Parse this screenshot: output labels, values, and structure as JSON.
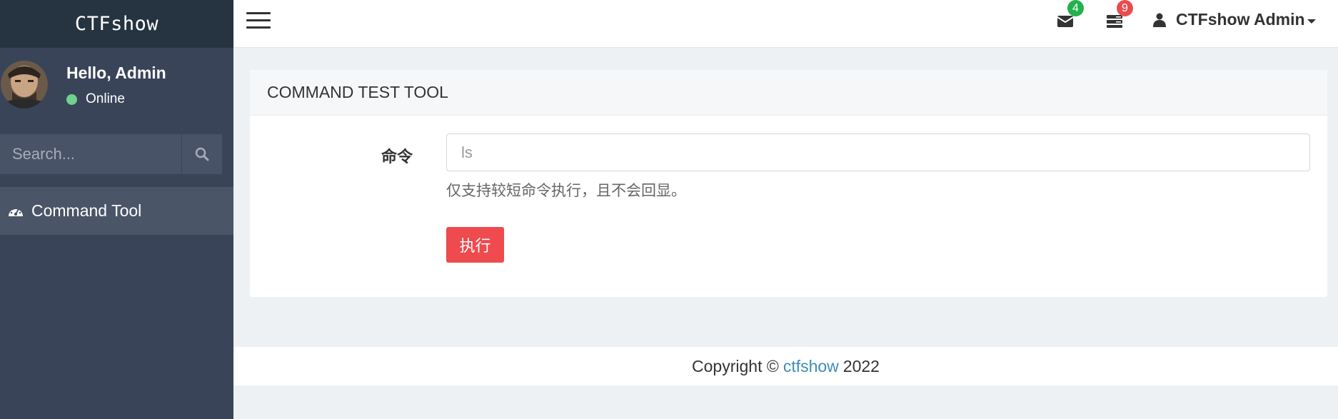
{
  "brand": "CTFshow",
  "user_panel": {
    "greeting": "Hello, Admin",
    "status": "Online"
  },
  "search": {
    "placeholder": "Search..."
  },
  "sidebar": {
    "items": [
      {
        "label": "Command Tool",
        "icon": "dashboard-icon"
      }
    ]
  },
  "topnav": {
    "messages_badge": "4",
    "tasks_badge": "9",
    "user_label": "CTFshow Admin"
  },
  "card": {
    "title": "COMMAND TEST TOOL",
    "field_label": "命令",
    "input_placeholder": "ls",
    "help_text": "仅支持较短命令执行，且不会回显。",
    "submit_label": "执行"
  },
  "footer": {
    "prefix": "Copyright ©",
    "link": "ctfshow",
    "year": "2022"
  },
  "colors": {
    "sidebar": "#3a4459",
    "brand_bg": "#263340",
    "danger": "#ef4a4e",
    "success": "#22b24c",
    "link": "#3c8dbc"
  }
}
